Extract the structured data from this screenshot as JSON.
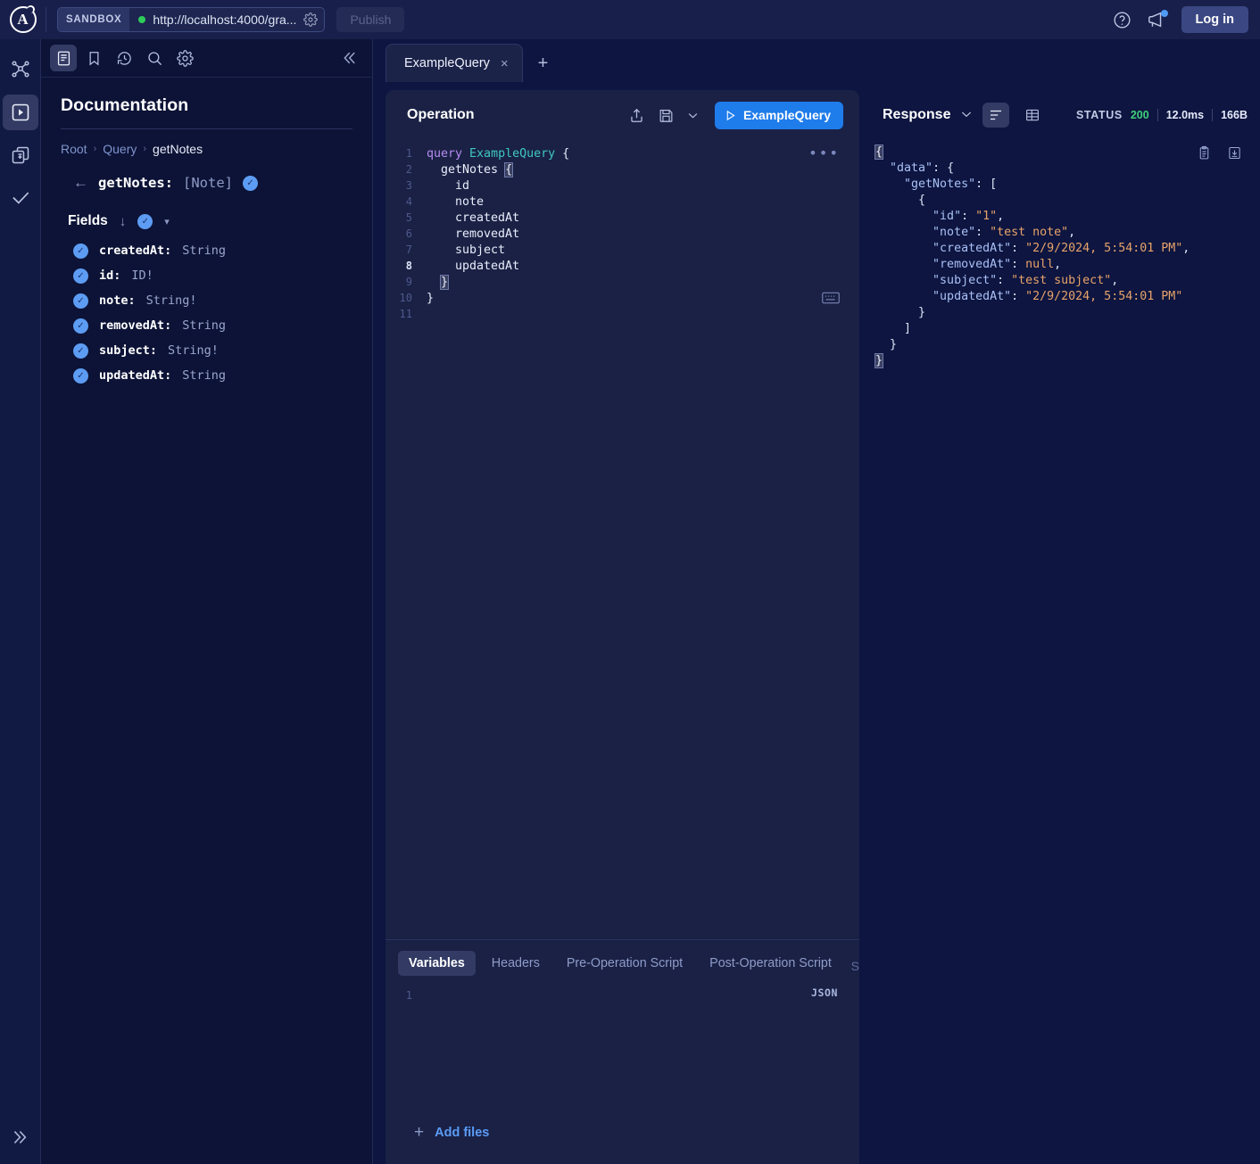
{
  "topbar": {
    "logo_letter": "A",
    "sandbox_label": "SANDBOX",
    "url": "http://localhost:4000/gra...",
    "publish_label": "Publish",
    "login_label": "Log in",
    "icons": {
      "graph": "graph-icon",
      "help": "help-circle-icon",
      "announcements": "megaphone-icon",
      "url_settings": "gear-icon"
    }
  },
  "rail": {
    "items": [
      {
        "name": "schema",
        "icon": "graph-nodes-icon",
        "active": false
      },
      {
        "name": "explorer",
        "icon": "play-box-icon",
        "active": true
      },
      {
        "name": "collections",
        "icon": "collections-icon",
        "active": false
      },
      {
        "name": "checks",
        "icon": "checkmark-icon",
        "active": false
      }
    ],
    "expand_label": "»"
  },
  "docpanel": {
    "toolbar": [
      {
        "name": "documentation",
        "icon": "docs-icon",
        "active": true
      },
      {
        "name": "saved",
        "icon": "bookmark-icon",
        "active": false
      },
      {
        "name": "history",
        "icon": "history-icon",
        "active": false
      },
      {
        "name": "search",
        "icon": "search-icon",
        "active": false
      },
      {
        "name": "settings",
        "icon": "gear-icon",
        "active": false
      }
    ],
    "collapse_label": "«",
    "title": "Documentation",
    "breadcrumb": [
      "Root",
      "Query",
      "getNotes"
    ],
    "current_field": {
      "name": "getNotes:",
      "type": "[Note]"
    },
    "fields_label": "Fields",
    "fields": [
      {
        "name": "createdAt:",
        "type": "String"
      },
      {
        "name": "id:",
        "type": "ID!"
      },
      {
        "name": "note:",
        "type": "String!"
      },
      {
        "name": "removedAt:",
        "type": "String"
      },
      {
        "name": "subject:",
        "type": "String!"
      },
      {
        "name": "updatedAt:",
        "type": "String"
      }
    ]
  },
  "tabs": {
    "items": [
      {
        "label": "ExampleQuery",
        "active": true
      }
    ],
    "close_label": "×",
    "add_label": "+"
  },
  "operation": {
    "title": "Operation",
    "run_label": "ExampleQuery",
    "more_label": "•••",
    "icons": {
      "share": "share-icon",
      "save": "save-icon",
      "save_menu": "chevron-down-icon",
      "shortcuts": "keyboard-icon"
    },
    "code_lines": [
      {
        "n": "1",
        "segments": [
          {
            "t": "query ",
            "c": "kw"
          },
          {
            "t": "ExampleQuery",
            "c": "name"
          },
          {
            "t": " {",
            "c": "plain"
          }
        ]
      },
      {
        "n": "2",
        "segments": [
          {
            "t": "  getNotes ",
            "c": "plain"
          },
          {
            "t": "{",
            "c": "brace-hl"
          }
        ]
      },
      {
        "n": "3",
        "segments": [
          {
            "t": "    id",
            "c": "plain"
          }
        ]
      },
      {
        "n": "4",
        "segments": [
          {
            "t": "    note",
            "c": "plain"
          }
        ]
      },
      {
        "n": "5",
        "segments": [
          {
            "t": "    createdAt",
            "c": "plain"
          }
        ]
      },
      {
        "n": "6",
        "segments": [
          {
            "t": "    removedAt",
            "c": "plain"
          }
        ]
      },
      {
        "n": "7",
        "segments": [
          {
            "t": "    subject",
            "c": "plain"
          }
        ]
      },
      {
        "n": "8",
        "segments": [
          {
            "t": "    updatedAt",
            "c": "plain"
          }
        ],
        "current": true
      },
      {
        "n": "9",
        "segments": [
          {
            "t": "  ",
            "c": "plain"
          },
          {
            "t": "}",
            "c": "brace-hl"
          }
        ]
      },
      {
        "n": "10",
        "segments": [
          {
            "t": "}",
            "c": "plain"
          }
        ]
      },
      {
        "n": "11",
        "segments": [
          {
            "t": "",
            "c": "plain"
          }
        ]
      }
    ]
  },
  "bottom": {
    "tabs": [
      {
        "label": "Variables",
        "active": true
      },
      {
        "label": "Headers",
        "active": false
      },
      {
        "label": "Pre-Operation Script",
        "active": false
      },
      {
        "label": "Post-Operation Script",
        "active": false
      }
    ],
    "clipped_label": "S",
    "line_number": "1",
    "format_label": "JSON",
    "add_files_label": "Add files",
    "plus_label": "+"
  },
  "response": {
    "title": "Response",
    "caret": "⌄",
    "views": [
      {
        "name": "json-view",
        "icon": "lines-icon",
        "active": true
      },
      {
        "name": "table-view",
        "icon": "table-icon",
        "active": false
      }
    ],
    "status_label": "STATUS",
    "status_code": "200",
    "duration": "12.0ms",
    "size": "166B",
    "icons": {
      "copy": "clipboard-icon",
      "download": "download-icon"
    },
    "body_lines": [
      {
        "segments": [
          {
            "t": "{",
            "c": "hl-brace"
          }
        ]
      },
      {
        "segments": [
          {
            "t": "  ",
            "c": "punc"
          },
          {
            "t": "\"data\"",
            "c": "key"
          },
          {
            "t": ": {",
            "c": "punc"
          }
        ]
      },
      {
        "segments": [
          {
            "t": "    ",
            "c": "punc"
          },
          {
            "t": "\"getNotes\"",
            "c": "key"
          },
          {
            "t": ": [",
            "c": "punc"
          }
        ]
      },
      {
        "segments": [
          {
            "t": "      {",
            "c": "punc"
          }
        ]
      },
      {
        "segments": [
          {
            "t": "        ",
            "c": "punc"
          },
          {
            "t": "\"id\"",
            "c": "key"
          },
          {
            "t": ": ",
            "c": "punc"
          },
          {
            "t": "\"1\"",
            "c": "str"
          },
          {
            "t": ",",
            "c": "punc"
          }
        ]
      },
      {
        "segments": [
          {
            "t": "        ",
            "c": "punc"
          },
          {
            "t": "\"note\"",
            "c": "key"
          },
          {
            "t": ": ",
            "c": "punc"
          },
          {
            "t": "\"test note\"",
            "c": "str"
          },
          {
            "t": ",",
            "c": "punc"
          }
        ]
      },
      {
        "segments": [
          {
            "t": "        ",
            "c": "punc"
          },
          {
            "t": "\"createdAt\"",
            "c": "key"
          },
          {
            "t": ": ",
            "c": "punc"
          },
          {
            "t": "\"2/9/2024, 5:54:01 PM\"",
            "c": "str"
          },
          {
            "t": ",",
            "c": "punc"
          }
        ]
      },
      {
        "segments": [
          {
            "t": "        ",
            "c": "punc"
          },
          {
            "t": "\"removedAt\"",
            "c": "key"
          },
          {
            "t": ": ",
            "c": "punc"
          },
          {
            "t": "null",
            "c": "null"
          },
          {
            "t": ",",
            "c": "punc"
          }
        ]
      },
      {
        "segments": [
          {
            "t": "        ",
            "c": "punc"
          },
          {
            "t": "\"subject\"",
            "c": "key"
          },
          {
            "t": ": ",
            "c": "punc"
          },
          {
            "t": "\"test subject\"",
            "c": "str"
          },
          {
            "t": ",",
            "c": "punc"
          }
        ]
      },
      {
        "segments": [
          {
            "t": "        ",
            "c": "punc"
          },
          {
            "t": "\"updatedAt\"",
            "c": "key"
          },
          {
            "t": ": ",
            "c": "punc"
          },
          {
            "t": "\"2/9/2024, 5:54:01 PM\"",
            "c": "str"
          }
        ]
      },
      {
        "segments": [
          {
            "t": "      }",
            "c": "punc"
          }
        ]
      },
      {
        "segments": [
          {
            "t": "    ]",
            "c": "punc"
          }
        ]
      },
      {
        "segments": [
          {
            "t": "  }",
            "c": "punc"
          }
        ]
      },
      {
        "segments": [
          {
            "t": "}",
            "c": "hl-brace"
          }
        ]
      }
    ]
  },
  "colors": {
    "accent_blue": "#1f7ceb",
    "status_green": "#3fd07a",
    "bg": "#0d1540",
    "panel": "#1a2145",
    "check_blue": "#5d9cf3"
  }
}
